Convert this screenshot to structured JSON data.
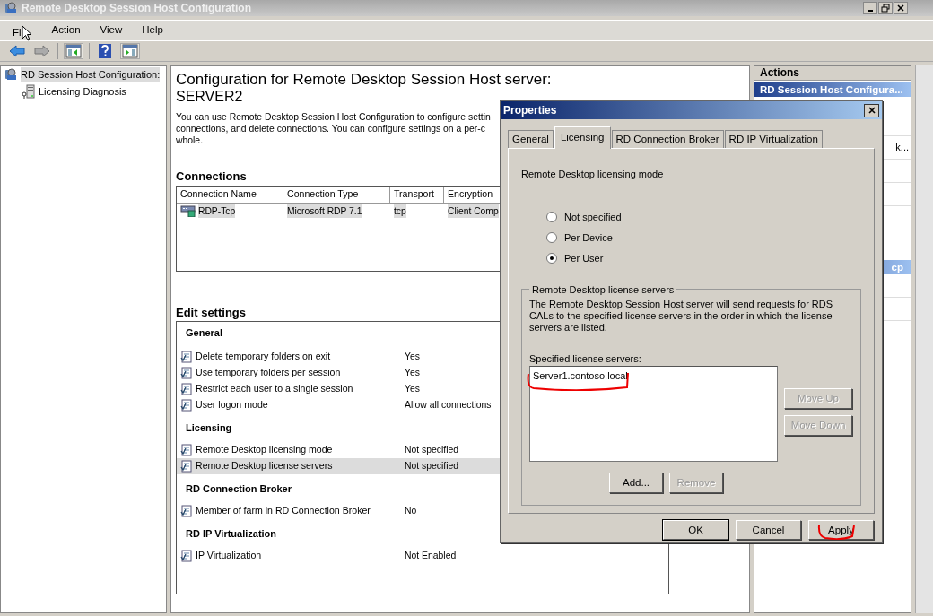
{
  "window": {
    "title": "Remote Desktop Session Host Configuration"
  },
  "menu": [
    "Fi",
    "Action",
    "View",
    "Help"
  ],
  "tree": [
    {
      "label": "RD Session Host Configuration:",
      "selected": true,
      "children": [
        {
          "label": "Licensing Diagnosis",
          "selected": false
        }
      ]
    }
  ],
  "main": {
    "title": "Configuration for Remote Desktop Session Host server:",
    "server": "SERVER2",
    "description_lines": [
      "You can use Remote Desktop Session Host Configuration to configure settin",
      "connections, and delete connections. You can configure settings on a per-c",
      "whole."
    ],
    "connections": {
      "heading": "Connections",
      "columns": [
        "Connection Name",
        "Connection Type",
        "Transport",
        "Encryption"
      ],
      "rows": [
        {
          "cells": [
            "RDP-Tcp",
            "Microsoft RDP 7.1",
            "tcp",
            "Client Comp"
          ],
          "selected": true
        }
      ]
    },
    "edit_settings": {
      "heading": "Edit settings",
      "groups": [
        {
          "name": "General",
          "rows": [
            {
              "name": "Delete temporary folders on exit",
              "value": "Yes",
              "selected": false
            },
            {
              "name": "Use temporary folders per session",
              "value": "Yes",
              "selected": false
            },
            {
              "name": "Restrict each user to a single session",
              "value": "Yes",
              "selected": false
            },
            {
              "name": "User logon mode",
              "value": "Allow all connections",
              "selected": false
            }
          ]
        },
        {
          "name": "Licensing",
          "rows": [
            {
              "name": "Remote Desktop licensing mode",
              "value": "Not specified",
              "selected": false
            },
            {
              "name": "Remote Desktop license servers",
              "value": "Not specified",
              "selected": true
            }
          ]
        },
        {
          "name": "RD Connection Broker",
          "rows": [
            {
              "name": "Member of farm in RD Connection Broker",
              "value": "No",
              "selected": false
            }
          ]
        },
        {
          "name": "RD IP Virtualization",
          "rows": [
            {
              "name": "IP Virtualization",
              "value": "Not Enabled",
              "selected": false
            }
          ]
        }
      ]
    }
  },
  "actions": {
    "heading": "Actions",
    "sections": [
      {
        "title": "RD Session Host Configura...",
        "items": [
          "k..."
        ]
      },
      {
        "title": "cp"
      }
    ]
  },
  "dialog": {
    "title": "Properties",
    "tabs": [
      {
        "label": "General",
        "selected": false
      },
      {
        "label": "Licensing",
        "selected": true
      },
      {
        "label": "RD Connection Broker",
        "selected": false
      },
      {
        "label": "RD IP Virtualization",
        "selected": false
      }
    ],
    "mode_label": "Remote Desktop licensing mode",
    "modes": [
      {
        "label": "Not specified",
        "selected": false
      },
      {
        "label": "Per Device",
        "selected": false
      },
      {
        "label": "Per User",
        "selected": true
      }
    ],
    "servers_group": {
      "legend": "Remote Desktop license servers",
      "description": "The Remote Desktop Session Host server will send requests for RDS CALs to the specified license servers in the order in which the license servers are listed.",
      "list_label": "Specified license servers:",
      "servers": [
        "Server1.contoso.local"
      ],
      "side_buttons": [
        {
          "label": "Move Up",
          "disabled": true
        },
        {
          "label": "Move Down",
          "disabled": true
        }
      ],
      "buttons": [
        {
          "label": "Add...",
          "disabled": false
        },
        {
          "label": "Remove",
          "disabled": true
        }
      ]
    },
    "buttons": [
      {
        "label": "OK",
        "default": true
      },
      {
        "label": "Cancel",
        "default": false
      },
      {
        "label": "Apply",
        "default": false
      }
    ]
  }
}
